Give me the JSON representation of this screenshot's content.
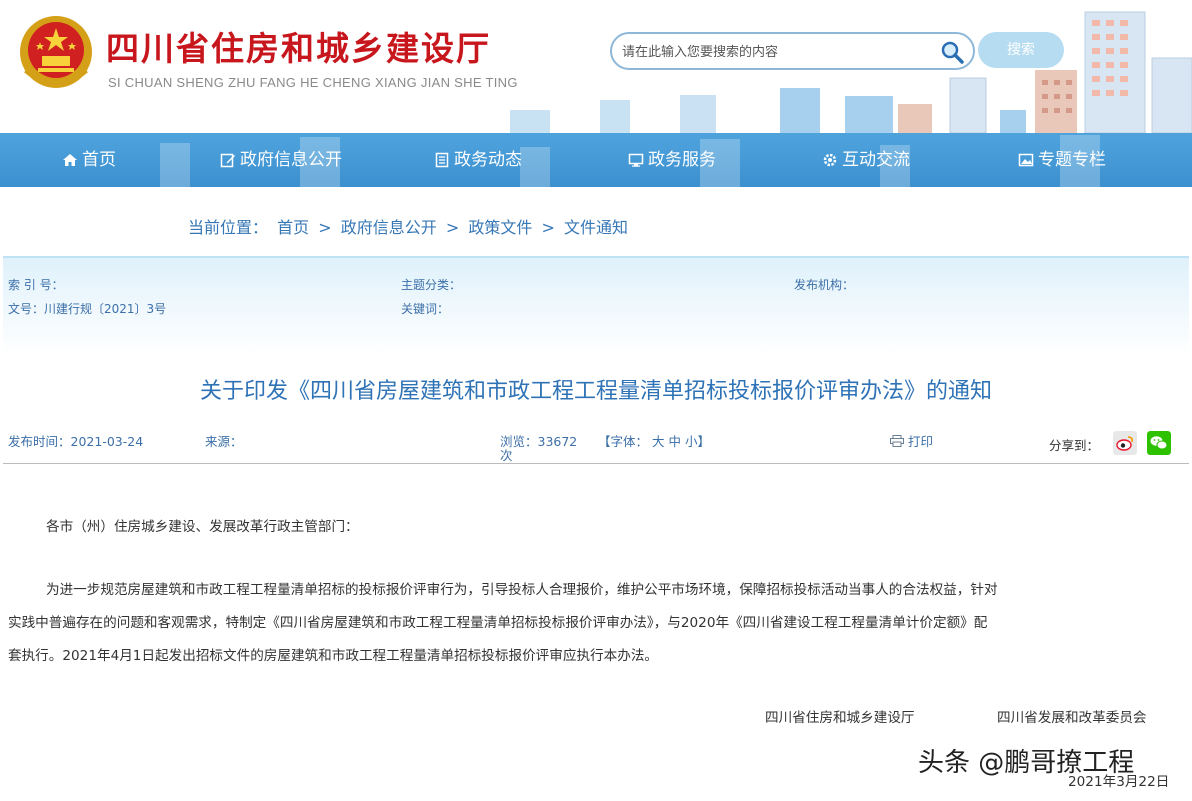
{
  "header": {
    "title": "四川省住房和城乡建设厅",
    "pinyin": "SI CHUAN SHENG ZHU FANG HE CHENG XIANG JIAN SHE TING",
    "search_placeholder": "请在此输入您要搜索的内容",
    "search_button": "搜索"
  },
  "nav": {
    "items": [
      {
        "label": "首页",
        "icon": "home-icon"
      },
      {
        "label": "政府信息公开",
        "icon": "edit-icon"
      },
      {
        "label": "政务动态",
        "icon": "document-icon"
      },
      {
        "label": "政务服务",
        "icon": "monitor-icon"
      },
      {
        "label": "互动交流",
        "icon": "gear-icon"
      },
      {
        "label": "专题专栏",
        "icon": "image-icon"
      }
    ]
  },
  "breadcrumb": {
    "prefix": "当前位置：",
    "items": [
      "首页",
      "政府信息公开",
      "政策文件",
      "文件通知"
    ],
    "separator": ">"
  },
  "info": {
    "index_label": "索 引 号：",
    "topic_label": "主题分类：",
    "org_label": "发布机构：",
    "docno": "文号：川建行规〔2021〕3号",
    "keyword_label": "关键词："
  },
  "document": {
    "title": "关于印发《四川省房屋建筑和市政工程工程量清单招标投标报价评审办法》的通知"
  },
  "meta": {
    "date": "发布时间：2021-03-24",
    "source": "来源：",
    "views": "浏览：33672",
    "views_unit": "次",
    "font_prefix": "【字体：",
    "font_large": "大",
    "font_medium": "中",
    "font_small": "小】",
    "print": "打印",
    "share": "分享到："
  },
  "body": {
    "salutation": "各市（州）住房城乡建设、发展改革行政主管部门：",
    "paragraph_lines": [
      "为进一步规范房屋建筑和市政工程工程量清单招标的投标报价评审行为，引导投标人合理报价，维护公平市场环境，保障招标投标活动当事人的合法权益，针对",
      "实践中普遍存在的问题和客观需求，特制定《四川省房屋建筑和市政工程工程量清单招标投标报价评审办法》，与2020年《四川省建设工程工程量清单计价定额》配",
      "套执行。2021年4月1日起发出招标文件的房屋建筑和市政工程工程量清单招标投标报价评审应执行本办法。"
    ],
    "signer1": "四川省住房和城乡建设厅",
    "signer2": "四川省发展和改革委员会",
    "date": "2021年3月22日"
  },
  "watermark": "头条 @鹏哥撩工程",
  "colors": {
    "brand_red": "#c8161d",
    "nav_blue": "#3c90cf",
    "link_blue": "#3777b5",
    "title_blue": "#2f73b7"
  }
}
